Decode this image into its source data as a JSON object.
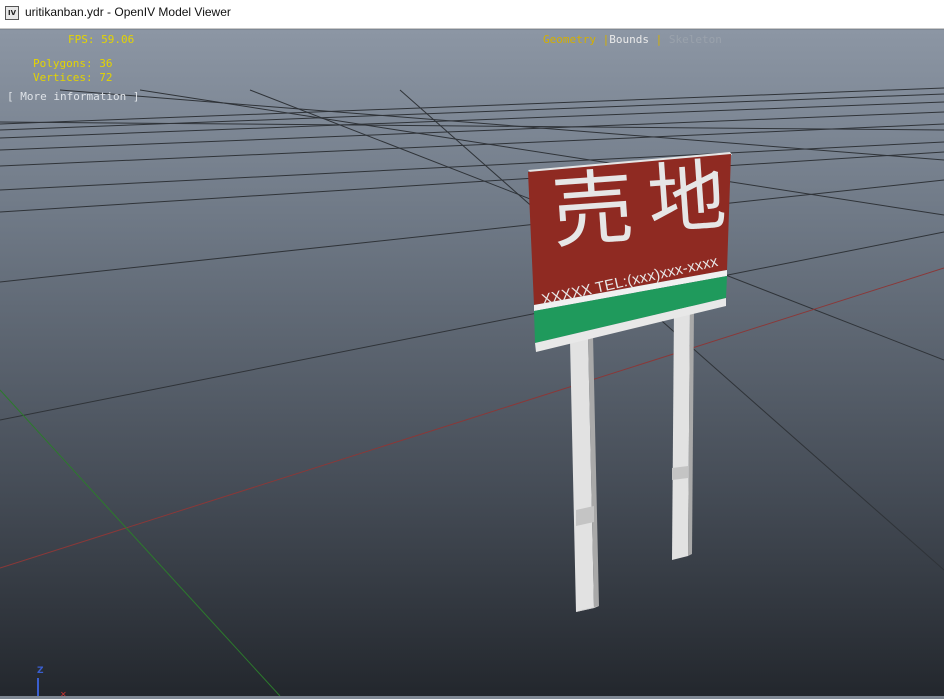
{
  "window": {
    "title": "uritikanban.ydr - OpenIV Model Viewer",
    "icon_label": "IV"
  },
  "stats": {
    "fps": "FPS: 59.06",
    "polygons": "Polygons: 36",
    "vertices": "Vertices: 72",
    "more_info": "[ More information ]"
  },
  "view_modes": {
    "geometry": "Geometry",
    "separator": "|",
    "bounds": "Bounds",
    "skeleton": "Skeleton"
  },
  "sign": {
    "kanji_left": "売",
    "kanji_right": "地",
    "contact_text": "XXXXX TEL:(xxx)xxx-xxxx",
    "panel_color": "#8f2a22",
    "strip_color": "#1f9a5c"
  },
  "axis": {
    "z_label": "Z"
  }
}
